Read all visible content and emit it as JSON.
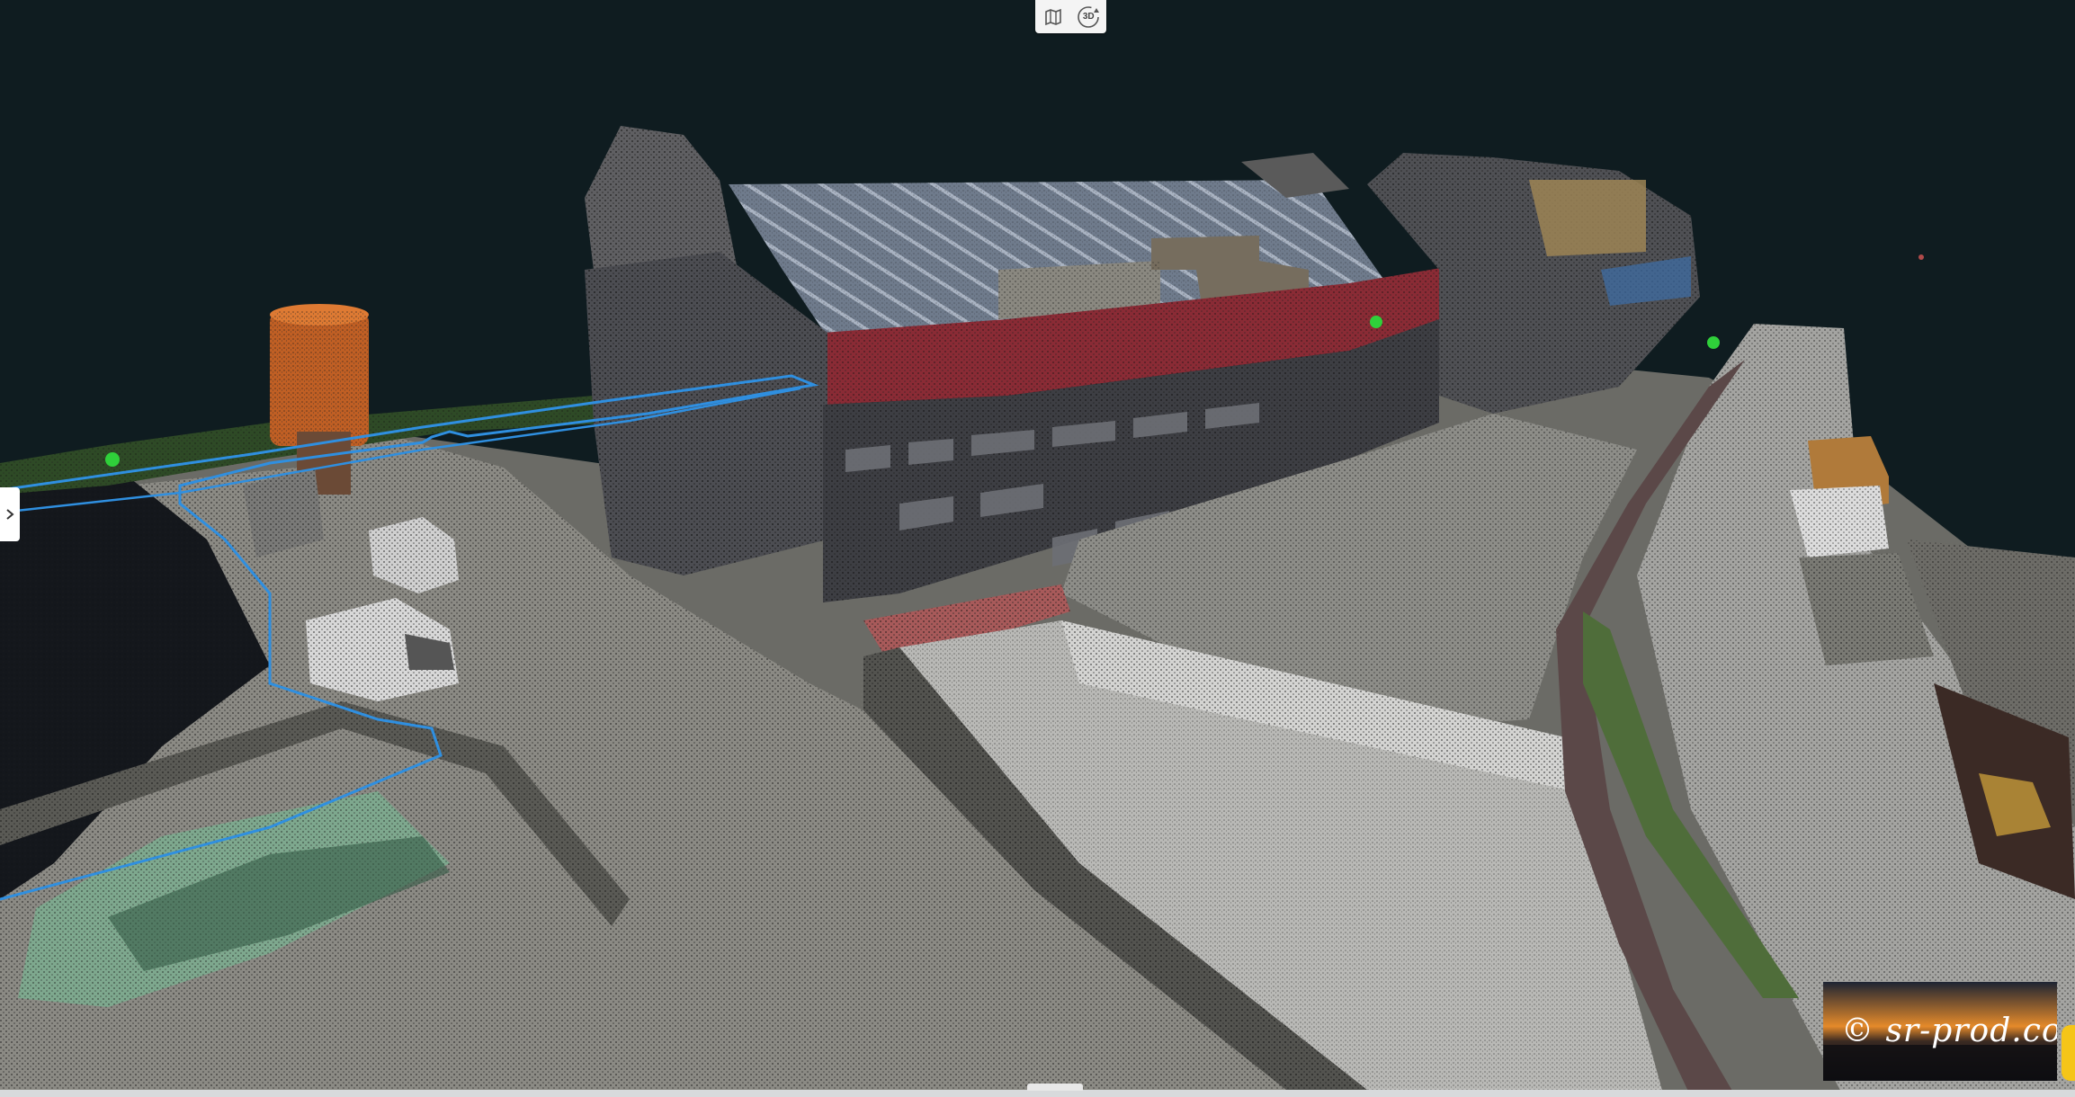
{
  "view_toggle": {
    "map_icon": "map-icon",
    "mode_3d_label": "3D",
    "mode_3d_icon": "rotate-3d-icon"
  },
  "sidebar_toggle": {
    "icon": "chevron-right-icon"
  },
  "watermark": {
    "text": "© sr-prod.com"
  },
  "colors": {
    "background": "#0f1c20",
    "route_line": "#2f8fe0",
    "marker": "#2fd03a",
    "accent_tab": "#f5c518"
  }
}
